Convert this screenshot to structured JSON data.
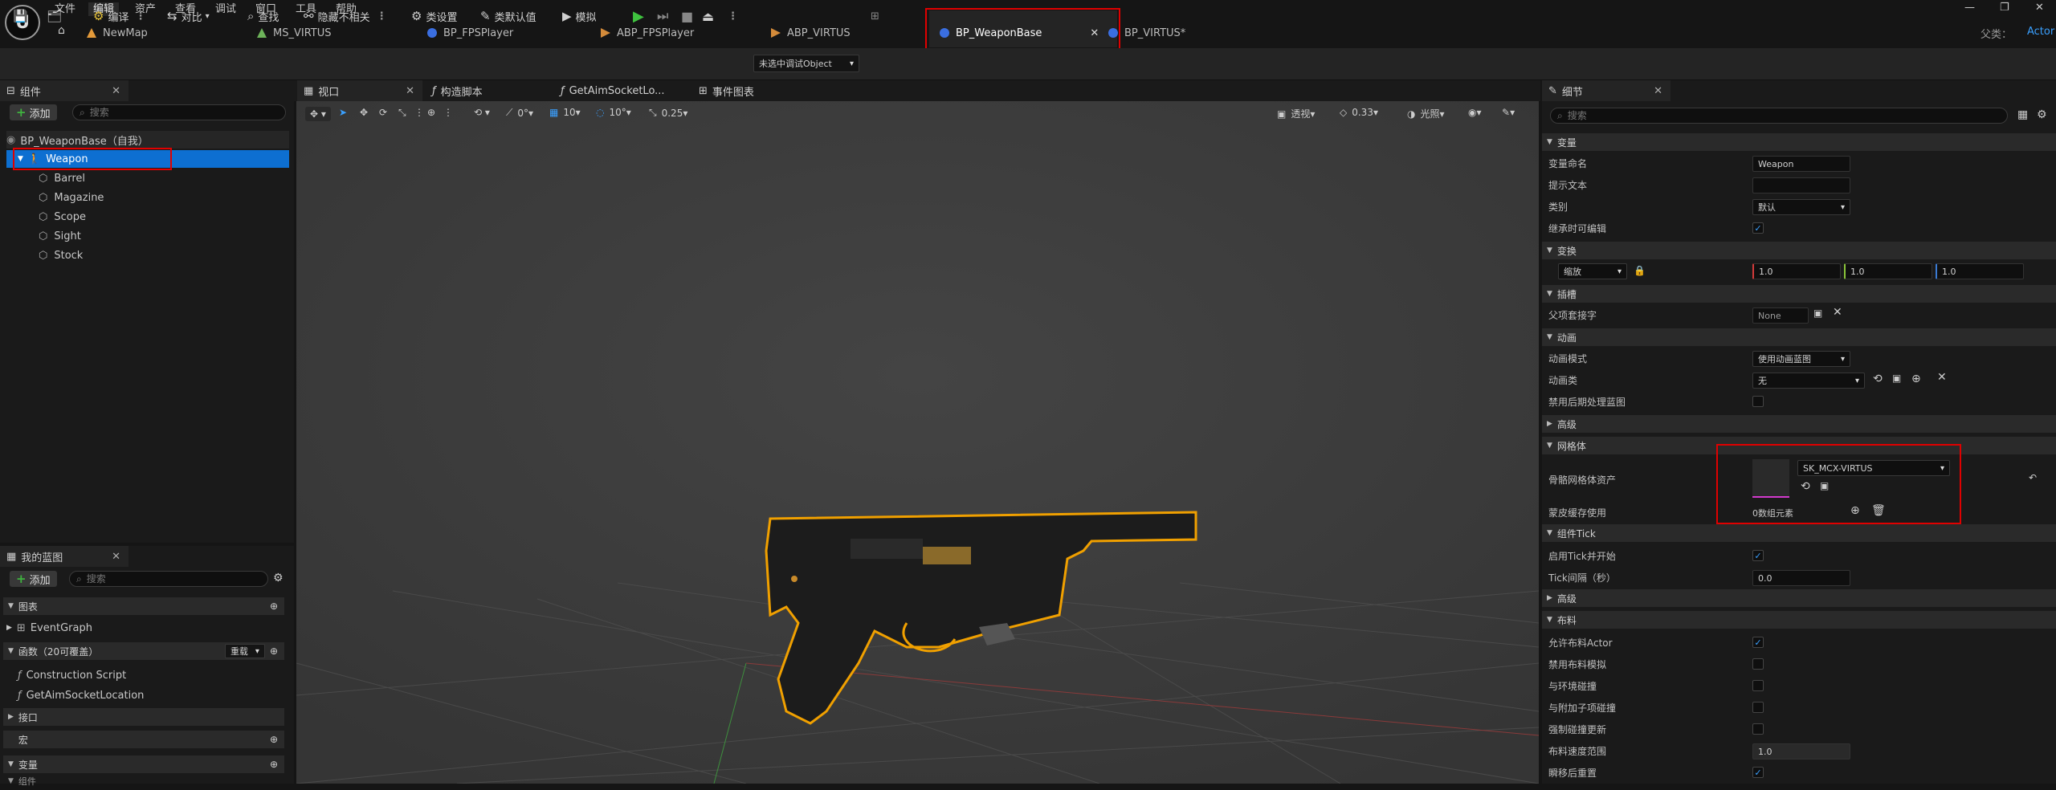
{
  "menu": [
    "文件",
    "编辑",
    "资产",
    "查看",
    "调试",
    "窗口",
    "工具",
    "帮助"
  ],
  "menu_active": "编辑",
  "window": {
    "parent_label": "父类：",
    "parent_value": "Actor"
  },
  "doc_tabs": [
    {
      "label": "NewMap",
      "color": "#e39a3a"
    },
    {
      "label": "MS_VIRTUS",
      "color": "#6db35a"
    },
    {
      "label": "BP_FPSPlayer",
      "color": "#3a6ee0"
    },
    {
      "label": "ABP_FPSPlayer",
      "color": "#d48b3a"
    },
    {
      "label": "ABP_VIRTUS",
      "color": "#d48b3a"
    },
    {
      "label": "BP_WeaponBase",
      "color": "#3a6ee0"
    },
    {
      "label": "BP_VIRTUS*",
      "color": "#3a6ee0"
    }
  ],
  "toolbar": {
    "compile": "编译",
    "diff": "对比",
    "find": "查找",
    "hide_unrelated": "隐藏不相关",
    "class_settings": "类设置",
    "class_defaults": "类默认值",
    "simulate": "模拟",
    "debug_object": "未选中调试Object"
  },
  "components": {
    "tab": "组件",
    "add": "添加",
    "search_placeholder": "搜索",
    "root": "BP_WeaponBase（自我）",
    "selected": "Weapon",
    "children": [
      "Barrel",
      "Magazine",
      "Scope",
      "Sight",
      "Stock"
    ]
  },
  "my_blueprint": {
    "tab": "我的蓝图",
    "add": "添加",
    "search_placeholder": "搜索",
    "graphs": "图表",
    "event_graph": "EventGraph",
    "functions": "函数（20可覆盖）",
    "override": "重载",
    "function_items": [
      "Construction Script",
      "GetAimSocketLocation"
    ],
    "interfaces": "接口",
    "macros": "宏",
    "variables": "变量",
    "components_cat": "组件"
  },
  "center_tabs": [
    "视口",
    "构造脚本",
    "GetAimSocketLo...",
    "事件图表"
  ],
  "viewport_toolbar": {
    "rot": "0°",
    "grid": "10",
    "angle": "10°",
    "scale": "0.25",
    "perspective": "透视",
    "fov": "0.33",
    "lighting": "光照"
  },
  "details": {
    "tab": "细节",
    "search_placeholder": "搜索",
    "sections": {
      "variable": "变量",
      "transform": "变换",
      "sockets": "插槽",
      "animation": "动画",
      "advanced": "高级",
      "mesh": "网格体",
      "component_tick": "组件Tick",
      "advanced2": "高级",
      "cloth": "布料"
    },
    "props": {
      "var_name": "变量命名",
      "var_name_value": "Weapon",
      "tooltip": "提示文本",
      "tooltip_value": "",
      "category": "类别",
      "category_value": "默认",
      "editable_inherit": "继承时可编辑",
      "scale_mode": "缩放",
      "scale_x": "1.0",
      "scale_y": "1.0",
      "scale_z": "1.0",
      "parent_socket": "父项套接字",
      "parent_socket_value": "None",
      "anim_mode": "动画模式",
      "anim_mode_value": "使用动画蓝图",
      "anim_class": "动画类",
      "anim_class_value": "无",
      "disable_post": "禁用后期处理蓝图",
      "skeletal_mesh": "骨骼网格体资产",
      "skeletal_mesh_value": "SK_MCX-VIRTUS",
      "skin_cache": "蒙皮缓存使用",
      "skin_cache_value": "0数组元素",
      "tick_start": "启用Tick并开始",
      "tick_interval": "Tick间隔（秒）",
      "tick_interval_value": "0.0",
      "allow_cloth": "允许布料Actor",
      "disable_cloth_sim": "禁用布料模拟",
      "collide_env": "与环境碰撞",
      "collide_child": "与附加子项碰撞",
      "force_collision": "强制碰撞更新",
      "cloth_speed": "布料速度范围",
      "cloth_speed_value": "1.0",
      "teleport_reset": "瞬移后重置"
    }
  }
}
